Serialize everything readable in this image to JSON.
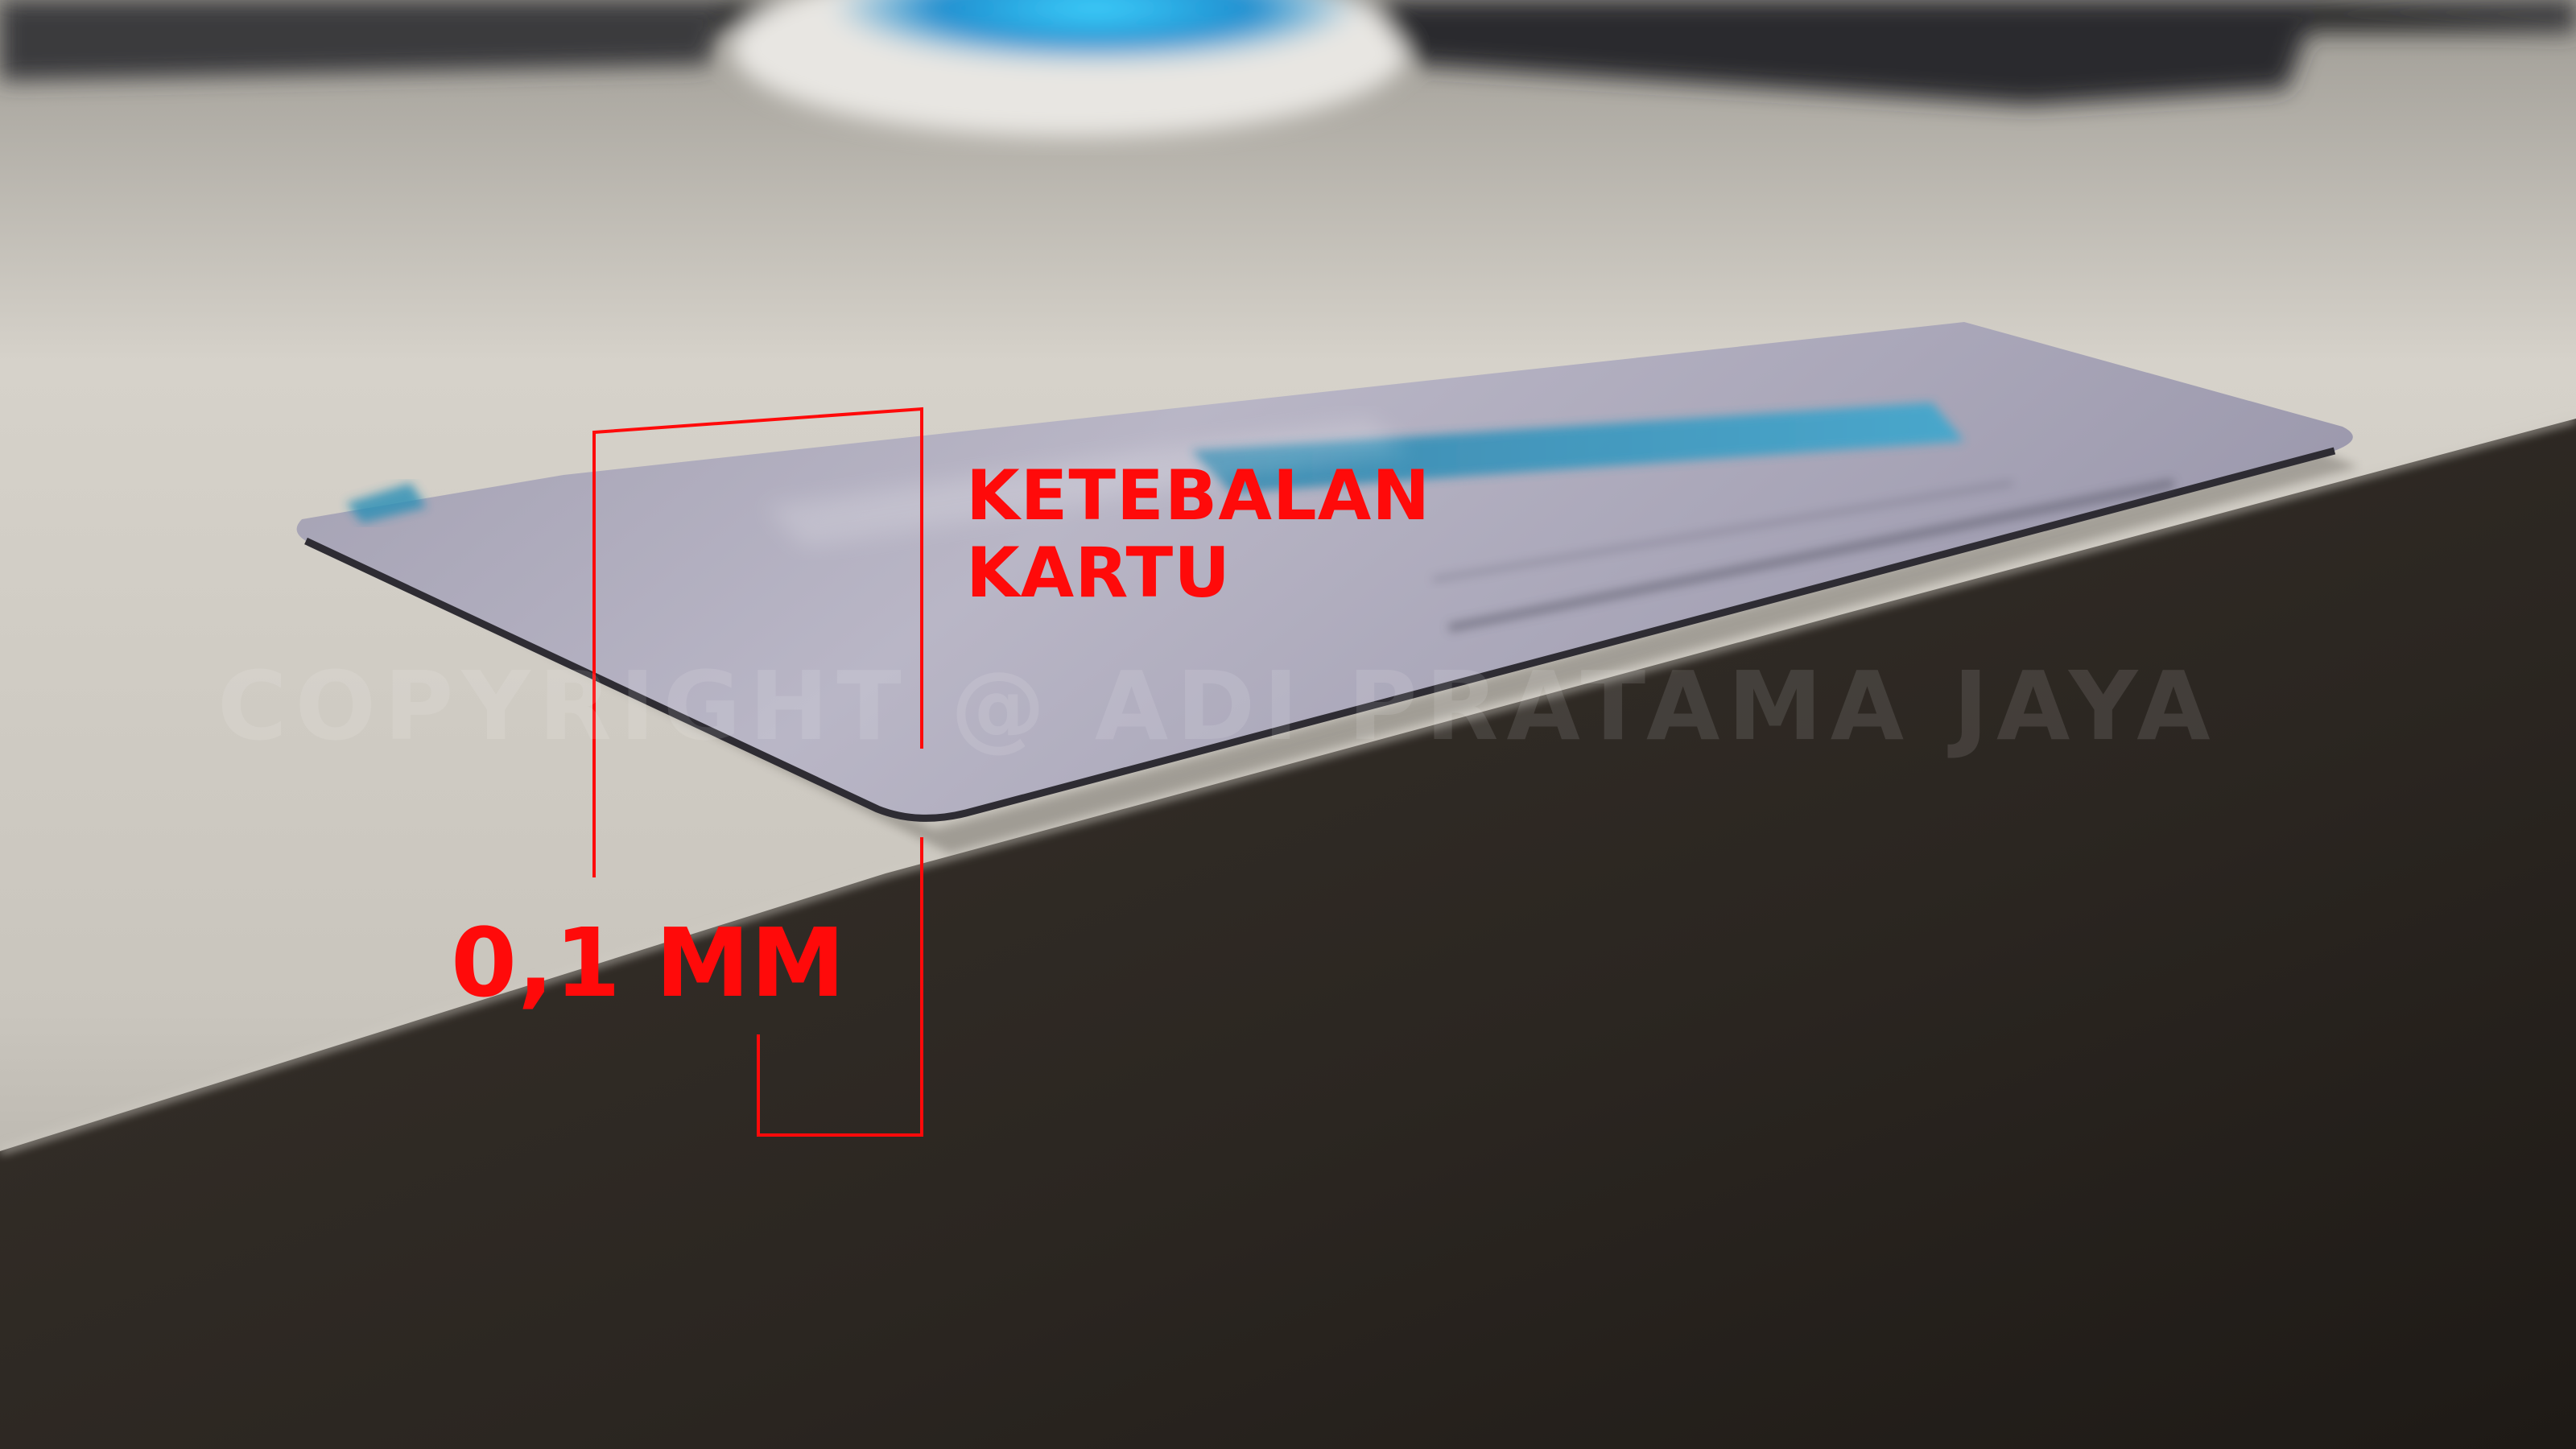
{
  "annotation": {
    "title_line1": "KETEBALAN",
    "title_line2": "KARTU",
    "measurement": "0,1 MM",
    "color": "#ff0a0a"
  },
  "watermark": {
    "text": "COPYRIGHT @ ADI PRATAMA JAYA"
  },
  "scene_colors": {
    "table_top": "#cbc7bf",
    "table_side": "#2c2722",
    "card": "#a9a6b6",
    "card_accent": "#2c8fb6"
  }
}
